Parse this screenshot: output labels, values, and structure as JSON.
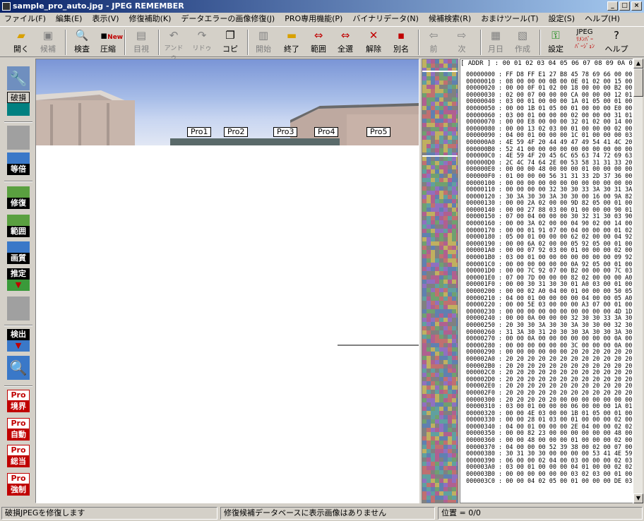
{
  "window": {
    "title": "sample_pro_auto.jpg - JPEG REMEMBER",
    "controls": [
      "_",
      "□",
      "×"
    ]
  },
  "menu": [
    "ファイル(F)",
    "編集(E)",
    "表示(V)",
    "修復補助(K)",
    "データエラーの画像修復(J)",
    "PRO専用機能(P)",
    "バイナリデータ(N)",
    "候補検索(R)",
    "おまけツール(T)",
    "設定(S)",
    "ヘルプ(H)"
  ],
  "toolbar": {
    "open": "開く",
    "candidate": "候補",
    "inspect": "検査",
    "compress": "圧縮",
    "visual": "目視",
    "undo": "アンドゥ",
    "redo": "リドゥ",
    "copy": "コピー",
    "start": "開始",
    "end": "終了",
    "range": "範囲",
    "select_all": "全選",
    "release": "解除",
    "rename": "別名",
    "prev": "前",
    "next": "次",
    "month_day": "月日",
    "create": "作成",
    "settings": "設定",
    "version_top": "JPEG",
    "version_mid": "ﾘﾒﾝﾊﾞｰ",
    "version_bot": "ﾊﾞｰｼﾞｮﾝ",
    "help": "ヘルプ",
    "new_badge": "New"
  },
  "sidebar": {
    "broken": "破損",
    "equal": "等倍",
    "repair": "修復",
    "range": "範囲",
    "quality": "画質",
    "estimate": "推定",
    "detect": "検出",
    "pro_tag": "Pro",
    "pro_border": "境界",
    "pro_auto": "自動",
    "pro_total": "総当",
    "pro_force": "強制"
  },
  "viewer": {
    "labels": [
      "Pro1",
      "Pro2",
      "Pro3",
      "Pro4",
      "Pro5"
    ]
  },
  "hex": {
    "header": "[ ADDR ] : 00 01 02 03 04 05 06 07 08 09 0A 0B",
    "rows": [
      "00000000 : FF D8 FF E1 27 B8 45 78 69 66 00 00",
      "00000010 : 08 00 00 00 0B 00 0E 01 02 00 15 00",
      "00000020 : 00 00 0F 01 02 00 18 00 00 00 B2 00",
      "00000030 : 02 00 07 00 00 00 CA 00 00 00 12 01",
      "00000040 : 03 00 01 00 00 00 1A 01 05 00 01 00",
      "00000050 : 00 00 1B 01 05 00 01 00 00 00 E0 00",
      "00000060 : 03 00 01 00 00 00 02 00 00 00 31 01",
      "00000070 : 00 00 E8 00 00 00 32 01 02 00 14 00",
      "00000080 : 00 00 13 02 03 00 01 00 00 00 02 00",
      "00000090 : 04 00 01 00 00 00 1C 01 00 00 00 03",
      "000000A0 : 4E 59 4F 20 44 49 47 49 54 41 4C 20",
      "000000B0 : 52 41 00 00 00 00 00 00 00 00 00 00",
      "000000C0 : 4E 59 4F 20 45 6C 65 63 74 72 69 63",
      "000000D0 : 2C 4C 74 64 2E 00 53 58 31 31 33 20",
      "000000E0 : 00 00 00 48 00 00 00 01 00 00 00 00",
      "000000F0 : 01 00 00 00 56 31 31 33 2D 37 36 00",
      "00000100 : 00 00 00 00 00 00 00 00 00 00 00 00",
      "00000110 : 00 00 00 00 32 30 30 33 3A 30 31 3A",
      "00000120 : 30 3A 30 30 3A 30 30 00 16 00 9A 82",
      "00000130 : 00 00 2A 02 00 00 9D 82 05 00 01 00",
      "00000140 : 00 00 27 88 03 00 01 00 00 00 90 01",
      "00000150 : 07 00 04 00 00 00 30 32 31 30 03 90",
      "00000160 : 00 00 3A 02 00 00 04 90 02 00 14 00",
      "00000170 : 00 00 01 91 07 00 04 00 00 00 01 02",
      "00000180 : 05 00 01 00 00 00 62 02 00 00 04 92",
      "00000190 : 00 00 6A 02 00 00 05 92 05 00 01 00",
      "000001A0 : 00 00 07 92 03 00 01 00 00 00 02 00",
      "000001B0 : 03 00 01 00 00 00 00 00 00 00 09 92",
      "000001C0 : 00 00 00 00 00 00 0A 92 05 00 01 00",
      "000001D0 : 00 00 7C 92 07 00 B2 00 00 00 7C 03",
      "000001E0 : 07 00 7D 00 00 00 82 02 00 00 00 A0",
      "000001F0 : 00 00 30 31 30 30 01 A0 03 00 01 00",
      "00000200 : 00 00 02 A0 04 00 01 00 00 00 50 05",
      "00000210 : 04 00 01 00 00 00 00 04 00 00 05 A0",
      "00000220 : 00 00 5E 03 00 00 00 A3 07 00 01 00",
      "00000230 : 00 00 00 00 00 00 00 00 00 00 4D 1D",
      "00000240 : 00 00 0A 00 00 00 32 30 30 33 3A 30",
      "00000250 : 20 30 30 3A 30 30 3A 30 30 00 32 30",
      "00000260 : 31 3A 30 31 20 30 30 3A 30 30 3A 30",
      "00000270 : 00 00 0A 00 00 00 00 00 00 00 0A 00",
      "00000280 : 00 00 00 00 00 00 3C 00 00 00 0A 00",
      "00000290 : 00 00 00 00 00 00 20 20 20 20 20 20",
      "000002A0 : 20 20 20 20 20 20 20 20 20 20 20 20",
      "000002B0 : 20 20 20 20 20 20 20 20 20 20 20 20",
      "000002C0 : 20 20 20 20 20 20 20 20 20 20 20 20",
      "000002D0 : 20 20 20 20 20 20 20 20 20 20 20 20",
      "000002E0 : 20 20 20 20 20 20 20 20 20 20 20 20",
      "000002F0 : 20 20 20 20 20 20 20 20 20 20 20 20",
      "00000300 : 20 20 20 20 20 00 00 00 00 00 00 00",
      "00000310 : 03 00 01 00 00 00 06 00 00 00 1A 01",
      "00000320 : 00 00 4E 03 00 00 1B 01 05 00 01 00",
      "00000330 : 00 00 28 01 03 00 01 00 00 00 02 00",
      "00000340 : 04 00 01 00 00 00 2E 04 00 00 02 02",
      "00000350 : 00 00 82 23 00 00 00 00 00 00 48 00",
      "00000360 : 00 00 48 00 00 00 01 00 00 00 02 00",
      "00000370 : 04 00 00 00 52 39 38 00 02 00 07 00",
      "00000380 : 30 31 30 30 00 00 00 00 53 41 4E 59",
      "00000390 : 06 00 00 02 04 00 03 00 00 00 02 03",
      "000003A0 : 03 00 01 00 00 00 04 01 00 00 02 02",
      "000003B0 : 00 00 00 00 00 00 03 02 03 00 01 00",
      "000003C0 : 00 00 04 02 05 00 01 00 00 00 DE 03"
    ]
  },
  "status": {
    "left": "破損JPEGを修復します",
    "middle": "修復候補データベースに表示画像はありません",
    "right": "位置 = 0/0"
  }
}
